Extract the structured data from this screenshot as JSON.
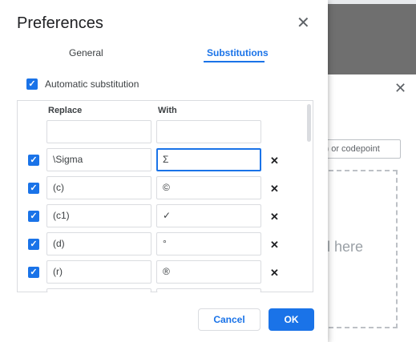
{
  "dialog": {
    "title": "Preferences",
    "tabs": [
      {
        "label": "General"
      },
      {
        "label": "Substitutions"
      }
    ],
    "auto_substitution_label": "Automatic substitution",
    "columns": {
      "replace": "Replace",
      "with": "With"
    },
    "rows": [
      {
        "replace": "\\Sigma",
        "with": "Σ"
      },
      {
        "replace": "(c)",
        "with": "©"
      },
      {
        "replace": "(c1)",
        "with": "✓"
      },
      {
        "replace": "(d)",
        "with": "°"
      },
      {
        "replace": "(r)",
        "with": "®"
      }
    ],
    "cancel_label": "Cancel",
    "ok_label": "OK",
    "close_glyph": "✕",
    "remove_glyph": "✕",
    "check_glyph": "✓"
  },
  "background": {
    "input_text": "y) or codepoint",
    "drop_text": "ol here",
    "close_glyph": "✕"
  },
  "colors": {
    "accent": "#1a73e8"
  }
}
